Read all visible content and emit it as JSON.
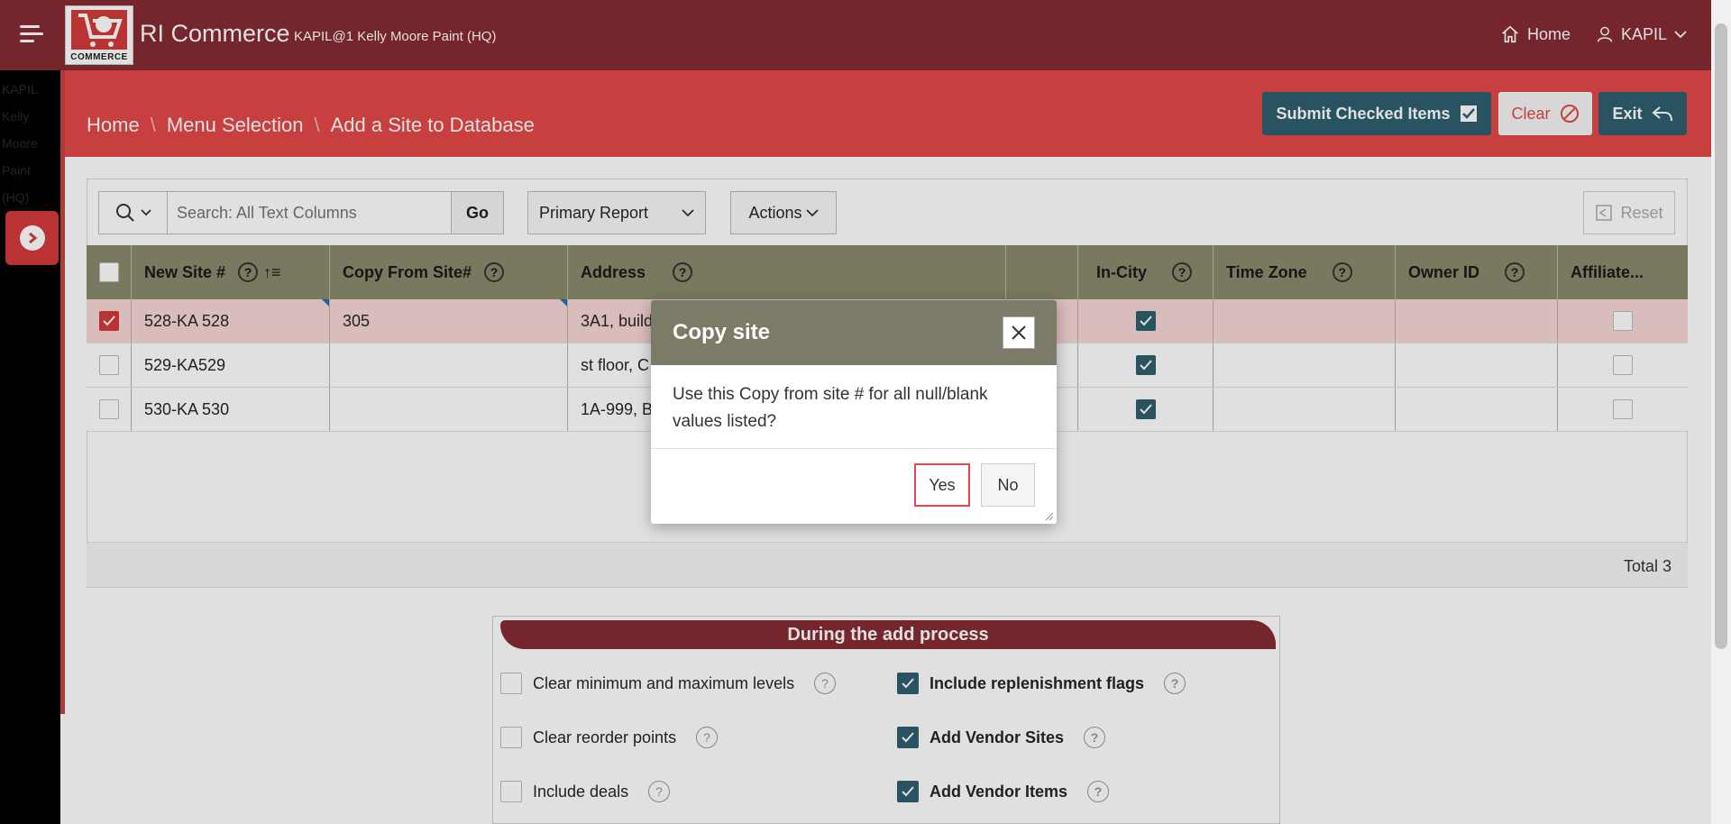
{
  "header": {
    "app_title": "RI Commerce",
    "subtitle": "KAPIL@1 Kelly Moore Paint (HQ)",
    "logo_text": "COMMERCE",
    "home_label": "Home",
    "user_label": "KAPIL"
  },
  "sidebar": {
    "ghost_text": "KAPIL Kelly Moore Paint (HQ)"
  },
  "breadcrumb": {
    "home": "Home",
    "menu": "Menu Selection",
    "current": "Add a Site to Database",
    "separator": "\\"
  },
  "actions": {
    "submit": "Submit Checked Items",
    "clear": "Clear",
    "exit": "Exit"
  },
  "toolbar": {
    "search_placeholder": "Search: All Text Columns",
    "go": "Go",
    "report": "Primary Report",
    "actions": "Actions",
    "reset": "Reset"
  },
  "grid": {
    "columns": [
      "New Site #",
      "Copy From Site#",
      "Address",
      "",
      "In-City",
      "Time Zone",
      "Owner ID",
      "Affiliate..."
    ],
    "rows": [
      {
        "site": "528-KA 528",
        "copy_from": "305",
        "address": "3A1, build",
        "checked": true,
        "in_city": true
      },
      {
        "site": "529-KA529",
        "copy_from": "",
        "address": "st floor, C",
        "checked": false,
        "in_city": true
      },
      {
        "site": "530-KA 530",
        "copy_from": "",
        "address": "1A-999, Bl",
        "checked": false,
        "in_city": true
      }
    ],
    "total": "Total 3"
  },
  "options": {
    "title": "During the add process",
    "items": [
      {
        "label": "Clear minimum and maximum levels",
        "checked": false
      },
      {
        "label": "Include replenishment flags",
        "checked": true
      },
      {
        "label": "Clear reorder points",
        "checked": false
      },
      {
        "label": "Add Vendor Sites",
        "checked": true
      },
      {
        "label": "Include deals",
        "checked": false
      },
      {
        "label": "Add Vendor Items",
        "checked": true
      }
    ]
  },
  "dialog": {
    "title": "Copy site",
    "message": "Use this Copy from site # for all null/blank values listed?",
    "yes": "Yes",
    "no": "No"
  },
  "colors": {
    "topbar": "#862c33",
    "breadcrumb_bar": "#e34848",
    "teal_button": "#305f6f",
    "grid_header": "#8a8a6e",
    "dialog_header": "#7b7b68"
  }
}
